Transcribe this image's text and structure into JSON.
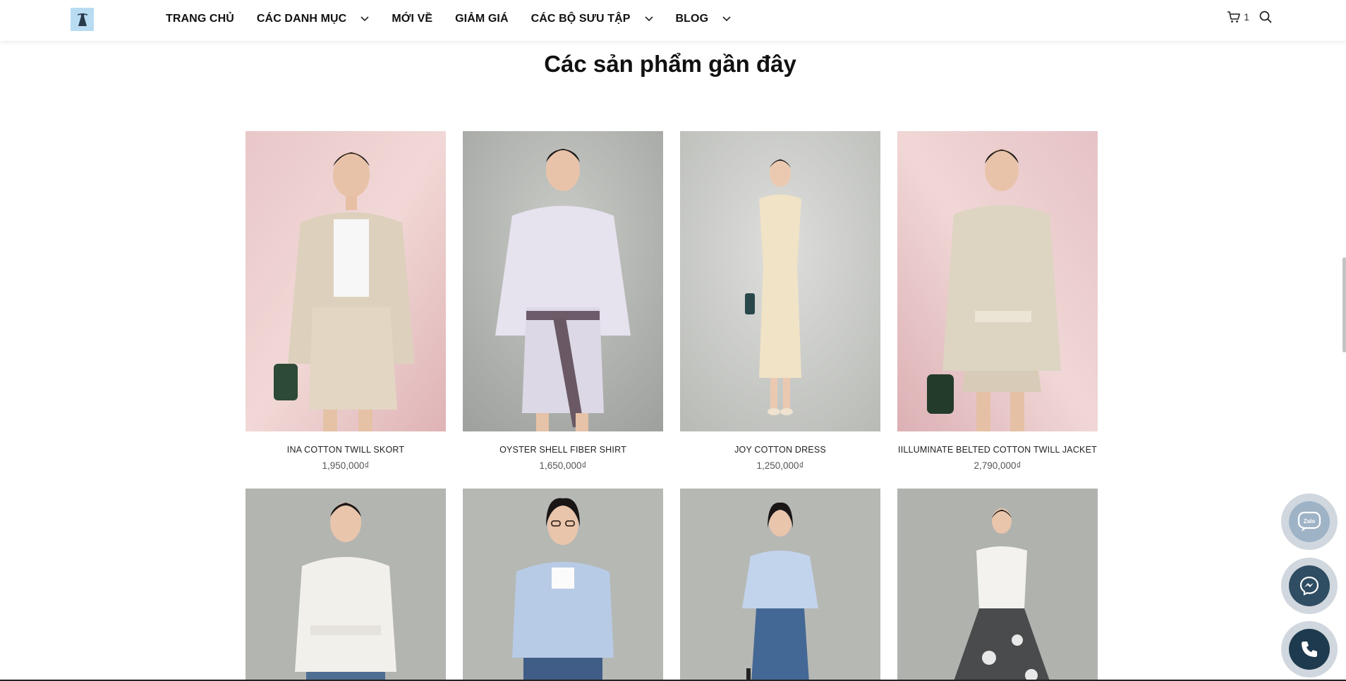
{
  "header": {
    "nav": [
      {
        "label": "TRANG CHỦ",
        "has_dropdown": false
      },
      {
        "label": "CÁC DANH MỤC",
        "has_dropdown": true
      },
      {
        "label": "MỚI VỀ",
        "has_dropdown": false
      },
      {
        "label": "GIẢM GIÁ",
        "has_dropdown": false
      },
      {
        "label": "CÁC BỘ SƯU TẬP",
        "has_dropdown": true
      },
      {
        "label": "BLOG",
        "has_dropdown": true
      }
    ],
    "cart_count": "1",
    "logo_icon": "dress-logo-icon",
    "cart_icon": "cart-icon",
    "search_icon": "search-icon"
  },
  "section": {
    "title": "Các sản phẩm gần đây"
  },
  "products_row1": [
    {
      "name": "INA COTTON TWILL SKORT",
      "price": "1,950,000₫"
    },
    {
      "name": "OYSTER SHELL FIBER SHIRT",
      "price": "1,650,000₫"
    },
    {
      "name": "JOY COTTON DRESS",
      "price": "1,250,000₫"
    },
    {
      "name": "IILLUMINATE BELTED COTTON TWILL JACKET",
      "price": "2,790,000₫"
    }
  ],
  "floating": {
    "zalo_label": "Zalo",
    "zalo_icon": "zalo-icon",
    "messenger_icon": "messenger-icon",
    "phone_icon": "phone-icon"
  },
  "colors": {
    "accent": "#111111",
    "price": "#555555",
    "logo_bg": "#b9dcf2"
  }
}
